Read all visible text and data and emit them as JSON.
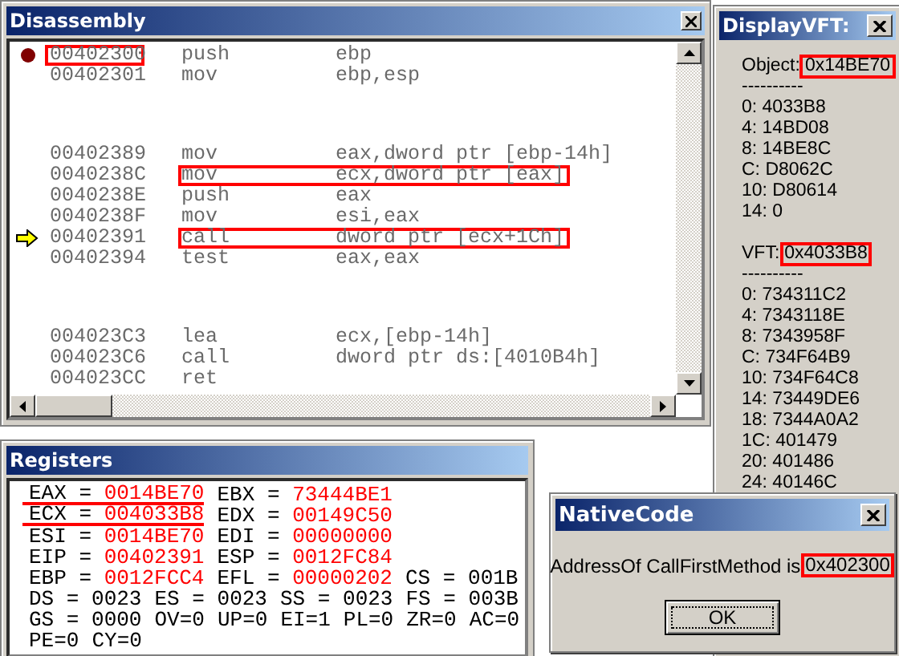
{
  "disassembly": {
    "title": "Disassembly",
    "segments": [
      {
        "rows": [
          {
            "address": "00402300",
            "mnemonic": "push",
            "operands": "ebp",
            "breakpoint": true,
            "current": false,
            "address_highlighted": true,
            "instruction_highlighted": false
          },
          {
            "address": "00402301",
            "mnemonic": "mov",
            "operands": "ebp,esp",
            "breakpoint": false,
            "current": false,
            "address_highlighted": false,
            "instruction_highlighted": false
          }
        ]
      },
      {
        "rows": [
          {
            "address": "00402389",
            "mnemonic": "mov",
            "operands": "eax,dword ptr [ebp-14h]",
            "breakpoint": false,
            "current": false,
            "address_highlighted": false,
            "instruction_highlighted": false
          },
          {
            "address": "0040238C",
            "mnemonic": "mov",
            "operands": "ecx,dword ptr [eax]",
            "breakpoint": false,
            "current": false,
            "address_highlighted": false,
            "instruction_highlighted": true
          },
          {
            "address": "0040238E",
            "mnemonic": "push",
            "operands": "eax",
            "breakpoint": false,
            "current": false,
            "address_highlighted": false,
            "instruction_highlighted": false
          },
          {
            "address": "0040238F",
            "mnemonic": "mov",
            "operands": "esi,eax",
            "breakpoint": false,
            "current": false,
            "address_highlighted": false,
            "instruction_highlighted": false
          },
          {
            "address": "00402391",
            "mnemonic": "call",
            "operands": "dword ptr [ecx+1Ch]",
            "breakpoint": false,
            "current": true,
            "address_highlighted": false,
            "instruction_highlighted": true
          },
          {
            "address": "00402394",
            "mnemonic": "test",
            "operands": "eax,eax",
            "breakpoint": false,
            "current": false,
            "address_highlighted": false,
            "instruction_highlighted": false
          }
        ]
      },
      {
        "rows": [
          {
            "address": "004023C3",
            "mnemonic": "lea",
            "operands": "ecx,[ebp-14h]",
            "breakpoint": false,
            "current": false,
            "address_highlighted": false,
            "instruction_highlighted": false
          },
          {
            "address": "004023C6",
            "mnemonic": "call",
            "operands": "dword ptr ds:[4010B4h]",
            "breakpoint": false,
            "current": false,
            "address_highlighted": false,
            "instruction_highlighted": false
          },
          {
            "address": "004023CC",
            "mnemonic": "ret",
            "operands": "",
            "breakpoint": false,
            "current": false,
            "address_highlighted": false,
            "instruction_highlighted": false
          }
        ]
      }
    ]
  },
  "display_vft": {
    "title": "DisplayVFT:",
    "object_label": "Object:",
    "object_value": "0x14BE70",
    "separator_1": "----------",
    "object_entries": [
      "0: 4033B8",
      "4: 14BD08",
      "8: 14BE8C",
      "C: D8062C",
      "10: D80614",
      "14: 0"
    ],
    "vft_label": "VFT:",
    "vft_value": "0x4033B8",
    "separator_2": "----------",
    "vft_entries": [
      "0: 734311C2",
      "4: 7343118E",
      "8: 7343958F",
      "C: 734F64B9",
      "10: 734F64C8",
      "14: 73449DE6",
      "18: 7344A0A2",
      "1C: 401479",
      "20: 401486",
      "24: 40146C"
    ]
  },
  "registers": {
    "title": "Registers",
    "lines": [
      [
        {
          "kind": "register",
          "label": "EAX =",
          "value": "0014BE70",
          "changed": true,
          "underlined": true
        },
        {
          "kind": "register",
          "label": "EBX =",
          "value": "73444BE1",
          "changed": true,
          "underlined": false
        }
      ],
      [
        {
          "kind": "register",
          "label": "ECX =",
          "value": "004033B8",
          "changed": true,
          "underlined": true
        },
        {
          "kind": "register",
          "label": "EDX =",
          "value": "00149C50",
          "changed": true,
          "underlined": false
        }
      ],
      [
        {
          "kind": "register",
          "label": "ESI =",
          "value": "0014BE70",
          "changed": true,
          "underlined": false
        },
        {
          "kind": "register",
          "label": "EDI =",
          "value": "00000000",
          "changed": true,
          "underlined": false
        }
      ],
      [
        {
          "kind": "register",
          "label": "EIP =",
          "value": "00402391",
          "changed": true,
          "underlined": false
        },
        {
          "kind": "register",
          "label": "ESP =",
          "value": "0012FC84",
          "changed": true,
          "underlined": false
        }
      ],
      [
        {
          "kind": "register",
          "label": "EBP =",
          "value": "0012FCC4",
          "changed": true,
          "underlined": false
        },
        {
          "kind": "register",
          "label": "EFL =",
          "value": "00000202",
          "changed": true,
          "underlined": false
        },
        {
          "kind": "register",
          "label": "CS =",
          "value": "001B",
          "changed": false,
          "underlined": false
        }
      ],
      [
        {
          "kind": "register",
          "label": "DS =",
          "value": "0023",
          "changed": false,
          "underlined": false
        },
        {
          "kind": "register",
          "label": "ES =",
          "value": "0023",
          "changed": false,
          "underlined": false
        },
        {
          "kind": "register",
          "label": "SS =",
          "value": "0023",
          "changed": false,
          "underlined": false
        },
        {
          "kind": "register",
          "label": "FS =",
          "value": "003B",
          "changed": false,
          "underlined": false
        }
      ],
      [
        {
          "kind": "register",
          "label": "GS =",
          "value": "0000",
          "changed": false,
          "underlined": false
        },
        {
          "kind": "flag",
          "text": "OV=0"
        },
        {
          "kind": "flag",
          "text": "UP=0"
        },
        {
          "kind": "flag",
          "text": "EI=1"
        },
        {
          "kind": "flag",
          "text": "PL=0"
        },
        {
          "kind": "flag",
          "text": "ZR=0"
        },
        {
          "kind": "flag",
          "text": "AC=0"
        }
      ],
      [
        {
          "kind": "flag",
          "text": "PE=0"
        },
        {
          "kind": "flag",
          "text": "CY=0"
        }
      ]
    ]
  },
  "dialog": {
    "title": "NativeCode",
    "message": "AddressOf CallFirstMethod is",
    "value": "0x402300",
    "button": "OK"
  }
}
